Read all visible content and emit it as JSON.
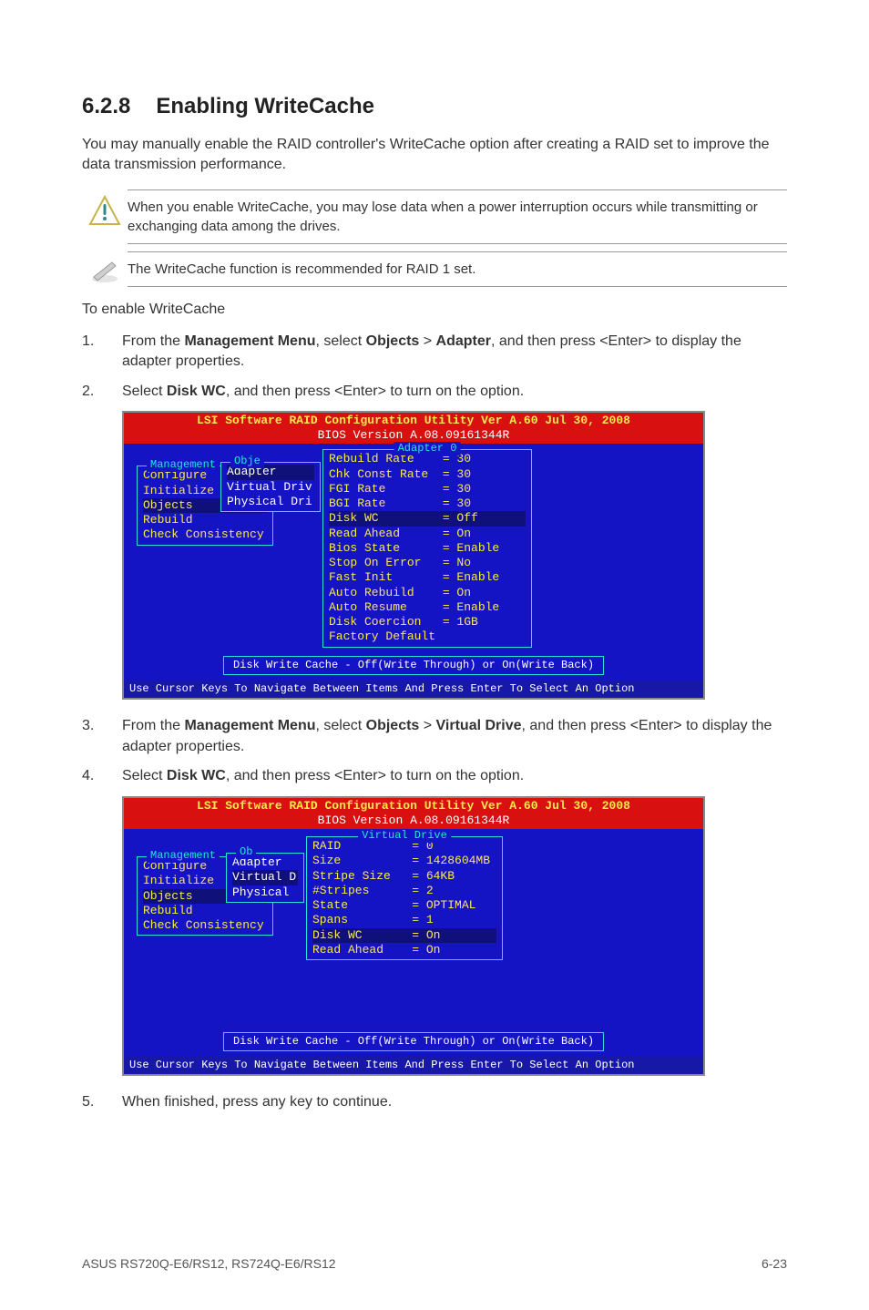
{
  "heading": {
    "num": "6.2.8",
    "title": "Enabling WriteCache"
  },
  "intro": "You may manually enable the RAID controller's WriteCache option after creating a RAID set to improve the data transmission performance.",
  "warn1": "When you enable WriteCache, you may lose data when a power interruption occurs while transmitting or exchanging data among the drives.",
  "warn2": "The WriteCache function is recommended for RAID 1 set.",
  "subhead": "To enable WriteCache",
  "steps": {
    "s1_pre": "From the ",
    "s1_b1": "Management Menu",
    "s1_mid1": ", select ",
    "s1_b2": "Objects",
    "s1_mid2": " > ",
    "s1_b3": "Adapter",
    "s1_post": ", and then press <Enter> to display the adapter properties.",
    "s2_pre": "Select ",
    "s2_b1": "Disk WC",
    "s2_post": ", and then press <Enter> to turn on the option.",
    "s3_pre": "From the ",
    "s3_b1": "Management Menu",
    "s3_mid1": ", select ",
    "s3_b2": "Objects",
    "s3_mid2": " > ",
    "s3_b3": "Virtual Drive",
    "s3_post": ", and then press <Enter> to display the adapter properties.",
    "s4_pre": "Select ",
    "s4_b1": "Disk WC",
    "s4_post": ", and then press <Enter> to turn on the option.",
    "s5": "When finished, press any key to continue."
  },
  "bios1": {
    "title": "LSI Software RAID Configuration Utility Ver A.60 Jul 30, 2008",
    "sub": "BIOS Version  A.08.09161344R",
    "mgmt_label": "Management",
    "mgmt": [
      "Configure",
      "Initialize",
      "Objects",
      "Rebuild",
      "Check Consistency"
    ],
    "objlabel": "Obje",
    "objmenu": [
      "Adapter",
      "Virtual Driv",
      "Physical Dri"
    ],
    "adapter_label": "Adapter 0",
    "props": [
      [
        "Rebuild Rate",
        "= 30"
      ],
      [
        "Chk Const Rate",
        "= 30"
      ],
      [
        "FGI Rate",
        "= 30"
      ],
      [
        "BGI Rate",
        "= 30"
      ],
      [
        "Disk WC",
        "= Off"
      ],
      [
        "Read Ahead",
        "= On"
      ],
      [
        "Bios State",
        "= Enable"
      ],
      [
        "Stop On Error",
        "= No"
      ],
      [
        "Fast Init",
        "= Enable"
      ],
      [
        "Auto Rebuild",
        "= On"
      ],
      [
        "Auto Resume",
        "= Enable"
      ],
      [
        "Disk Coercion",
        "= 1GB"
      ],
      [
        "Factory Default",
        ""
      ]
    ],
    "status": "Disk Write Cache - Off(Write Through) or On(Write Back)",
    "footer": "Use Cursor Keys To Navigate Between Items And Press Enter To Select An Option"
  },
  "bios2": {
    "title": "LSI Software RAID Configuration Utility Ver A.60 Jul 30, 2008",
    "sub": "BIOS Version  A.08.09161344R",
    "mgmt_label": "Management",
    "mgmt": [
      "Configure",
      "Initialize",
      "Objects",
      "Rebuild",
      "Check Consistency"
    ],
    "objlabel": "Ob",
    "objmenu": [
      "Adapter",
      "Virtual D",
      "Physical"
    ],
    "vd_label": "Virtual Drive",
    "props": [
      [
        "RAID",
        "= 0"
      ],
      [
        "Size",
        "= 1428604MB"
      ],
      [
        "Stripe Size",
        "= 64KB"
      ],
      [
        "#Stripes",
        "= 2"
      ],
      [
        "State",
        "= OPTIMAL"
      ],
      [
        "Spans",
        "= 1"
      ],
      [
        "Disk WC",
        "= On"
      ],
      [
        "Read Ahead",
        "= On"
      ]
    ],
    "status": "Disk Write Cache - Off(Write Through) or On(Write Back)",
    "footer": "Use Cursor Keys To Navigate Between Items And Press Enter To Select An Option"
  },
  "pagefooter": {
    "left": "ASUS RS720Q-E6/RS12, RS724Q-E6/RS12",
    "right": "6-23"
  }
}
